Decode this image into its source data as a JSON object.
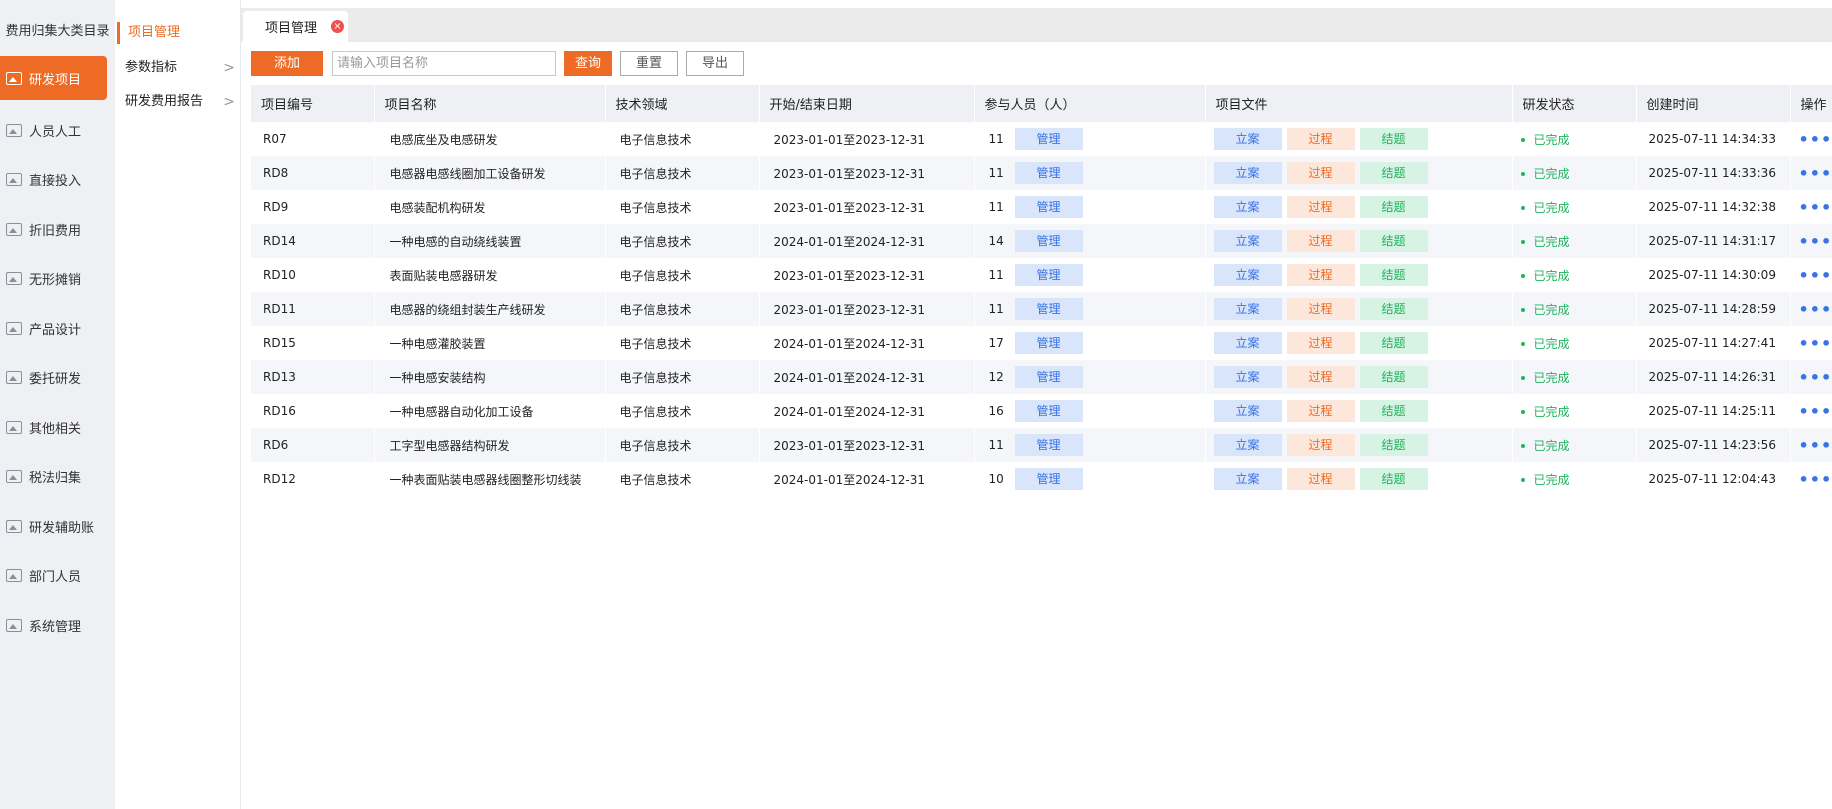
{
  "left_sidebar": {
    "title": "费用归集大类目录",
    "items": [
      {
        "label": "研发项目"
      },
      {
        "label": "人员人工"
      },
      {
        "label": "直接投入"
      },
      {
        "label": "折旧费用"
      },
      {
        "label": "无形摊销"
      },
      {
        "label": "产品设计"
      },
      {
        "label": "委托研发"
      },
      {
        "label": "其他相关"
      },
      {
        "label": "税法归集"
      },
      {
        "label": "研发辅助账"
      },
      {
        "label": "部门人员"
      },
      {
        "label": "系统管理"
      }
    ]
  },
  "sub_sidebar": {
    "title": "项目管理",
    "items": [
      {
        "label": "参数指标"
      },
      {
        "label": "研发费用报告"
      }
    ],
    "chevron": ">"
  },
  "tabs": [
    {
      "label": "项目管理",
      "close": "×"
    }
  ],
  "toolbar": {
    "add_label": "添加",
    "search_placeholder": "请输入项目名称",
    "search_value": "",
    "query_label": "查询",
    "reset_label": "重置",
    "export_label": "导出"
  },
  "table": {
    "headers": {
      "code": "项目编号",
      "name": "项目名称",
      "field": "技术领域",
      "date": "开始/结束日期",
      "people": "参与人员（人）",
      "files": "项目文件",
      "status": "研发状态",
      "created": "创建时间",
      "actions": "操作"
    },
    "buttons": {
      "manage": "管理",
      "start": "立案",
      "process": "过程",
      "finish": "结题",
      "more": "•••"
    },
    "rows": [
      {
        "code": "R07",
        "name": "电感底坐及电感研发",
        "field": "电子信息技术",
        "date": "2023-01-01至2023-12-31",
        "people": "11",
        "status": "已完成",
        "created": "2025-07-11 14:34:33"
      },
      {
        "code": "RD8",
        "name": "电感器电感线圈加工设备研发",
        "field": "电子信息技术",
        "date": "2023-01-01至2023-12-31",
        "people": "11",
        "status": "已完成",
        "created": "2025-07-11 14:33:36"
      },
      {
        "code": "RD9",
        "name": "电感装配机构研发",
        "field": "电子信息技术",
        "date": "2023-01-01至2023-12-31",
        "people": "11",
        "status": "已完成",
        "created": "2025-07-11 14:32:38"
      },
      {
        "code": "RD14",
        "name": "一种电感的自动绕线装置",
        "field": "电子信息技术",
        "date": "2024-01-01至2024-12-31",
        "people": "14",
        "status": "已完成",
        "created": "2025-07-11 14:31:17"
      },
      {
        "code": "RD10",
        "name": "表面贴装电感器研发",
        "field": "电子信息技术",
        "date": "2023-01-01至2023-12-31",
        "people": "11",
        "status": "已完成",
        "created": "2025-07-11 14:30:09"
      },
      {
        "code": "RD11",
        "name": "电感器的绕组封装生产线研发",
        "field": "电子信息技术",
        "date": "2023-01-01至2023-12-31",
        "people": "11",
        "status": "已完成",
        "created": "2025-07-11 14:28:59"
      },
      {
        "code": "RD15",
        "name": "一种电感灌胶装置",
        "field": "电子信息技术",
        "date": "2024-01-01至2024-12-31",
        "people": "17",
        "status": "已完成",
        "created": "2025-07-11 14:27:41"
      },
      {
        "code": "RD13",
        "name": "一种电感安装结构",
        "field": "电子信息技术",
        "date": "2024-01-01至2024-12-31",
        "people": "12",
        "status": "已完成",
        "created": "2025-07-11 14:26:31"
      },
      {
        "code": "RD16",
        "name": "一种电感器自动化加工设备",
        "field": "电子信息技术",
        "date": "2024-01-01至2024-12-31",
        "people": "16",
        "status": "已完成",
        "created": "2025-07-11 14:25:11"
      },
      {
        "code": "RD6",
        "name": "工字型电感器结构研发",
        "field": "电子信息技术",
        "date": "2023-01-01至2023-12-31",
        "people": "11",
        "status": "已完成",
        "created": "2025-07-11 14:23:56"
      },
      {
        "code": "RD12",
        "name": "一种表面贴装电感器线圈整形切线装",
        "field": "电子信息技术",
        "date": "2024-01-01至2024-12-31",
        "people": "10",
        "status": "已完成",
        "created": "2025-07-11 12:04:43"
      }
    ]
  },
  "colors": {
    "accent": "#ed6b25",
    "blue": "#3973e6",
    "green": "#22b35e"
  }
}
